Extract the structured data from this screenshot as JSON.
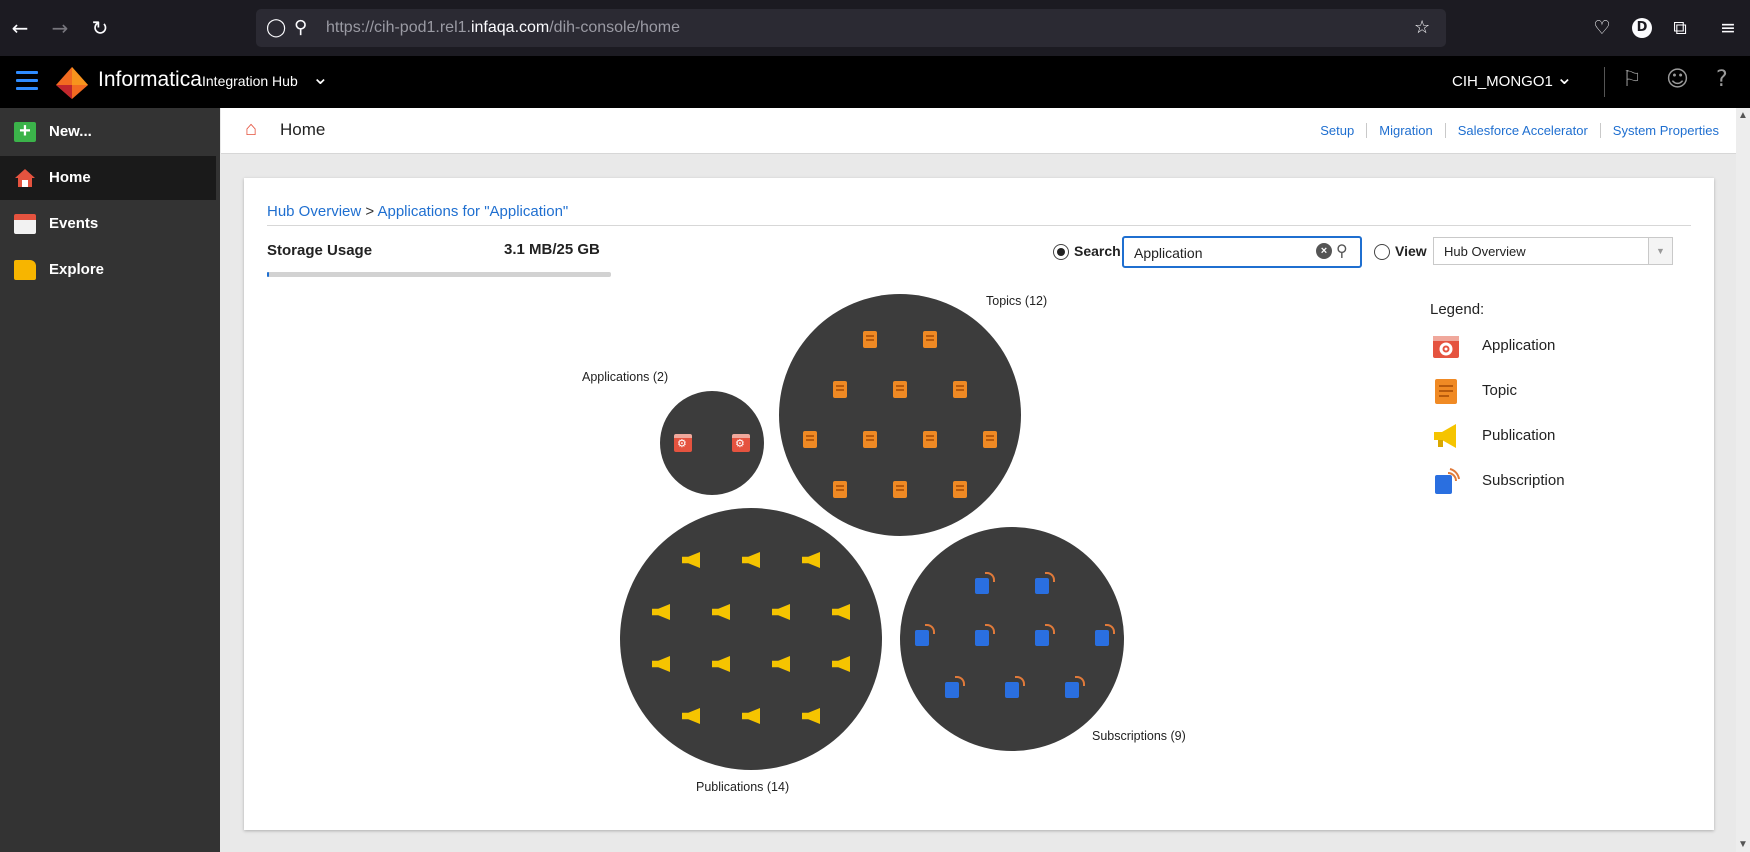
{
  "browser": {
    "url_prefix": "https://cih-pod1.rel1.",
    "url_domain": "infaqa.com",
    "url_path": "/dih-console/home",
    "profile_initial": "D"
  },
  "app_header": {
    "brand": "Informatica",
    "product": "Integration Hub",
    "org": "CIH_MONGO1"
  },
  "sidebar": {
    "items": [
      {
        "label": "New...",
        "icon": "plus-icon"
      },
      {
        "label": "Home",
        "icon": "home-icon"
      },
      {
        "label": "Events",
        "icon": "calendar-icon"
      },
      {
        "label": "Explore",
        "icon": "folder-icon"
      }
    ]
  },
  "page_header": {
    "title": "Home",
    "links": [
      "Setup",
      "Migration",
      "Salesforce Accelerator",
      "System Properties"
    ]
  },
  "card": {
    "breadcrumb_root": "Hub Overview",
    "breadcrumb_sep": " > ",
    "breadcrumb_current": "Applications for \"Application\"",
    "storage_label": "Storage Usage",
    "storage_value": "3.1 MB/25 GB",
    "search_label": "Search",
    "search_value": "Application",
    "view_label": "View",
    "view_value": "Hub Overview"
  },
  "legend": {
    "title": "Legend:",
    "items": [
      {
        "label": "Application",
        "icon": "application-icon",
        "color": "#e5533f"
      },
      {
        "label": "Topic",
        "icon": "topic-icon",
        "color": "#f08a24"
      },
      {
        "label": "Publication",
        "icon": "publication-icon",
        "color": "#f5c400"
      },
      {
        "label": "Subscription",
        "icon": "subscription-icon",
        "color": "#2a6fe0"
      }
    ]
  },
  "bubbles": {
    "applications": {
      "label": "Applications (2)",
      "count": 2
    },
    "topics": {
      "label": "Topics (12)",
      "count": 12
    },
    "publications": {
      "label": "Publications (14)",
      "count": 14
    },
    "subscriptions": {
      "label": "Subscriptions (9)",
      "count": 9
    }
  },
  "colors": {
    "accent": "#1f6fd0",
    "bubble": "#3c3c3c",
    "sidebar": "#333333",
    "header": "#000000"
  }
}
